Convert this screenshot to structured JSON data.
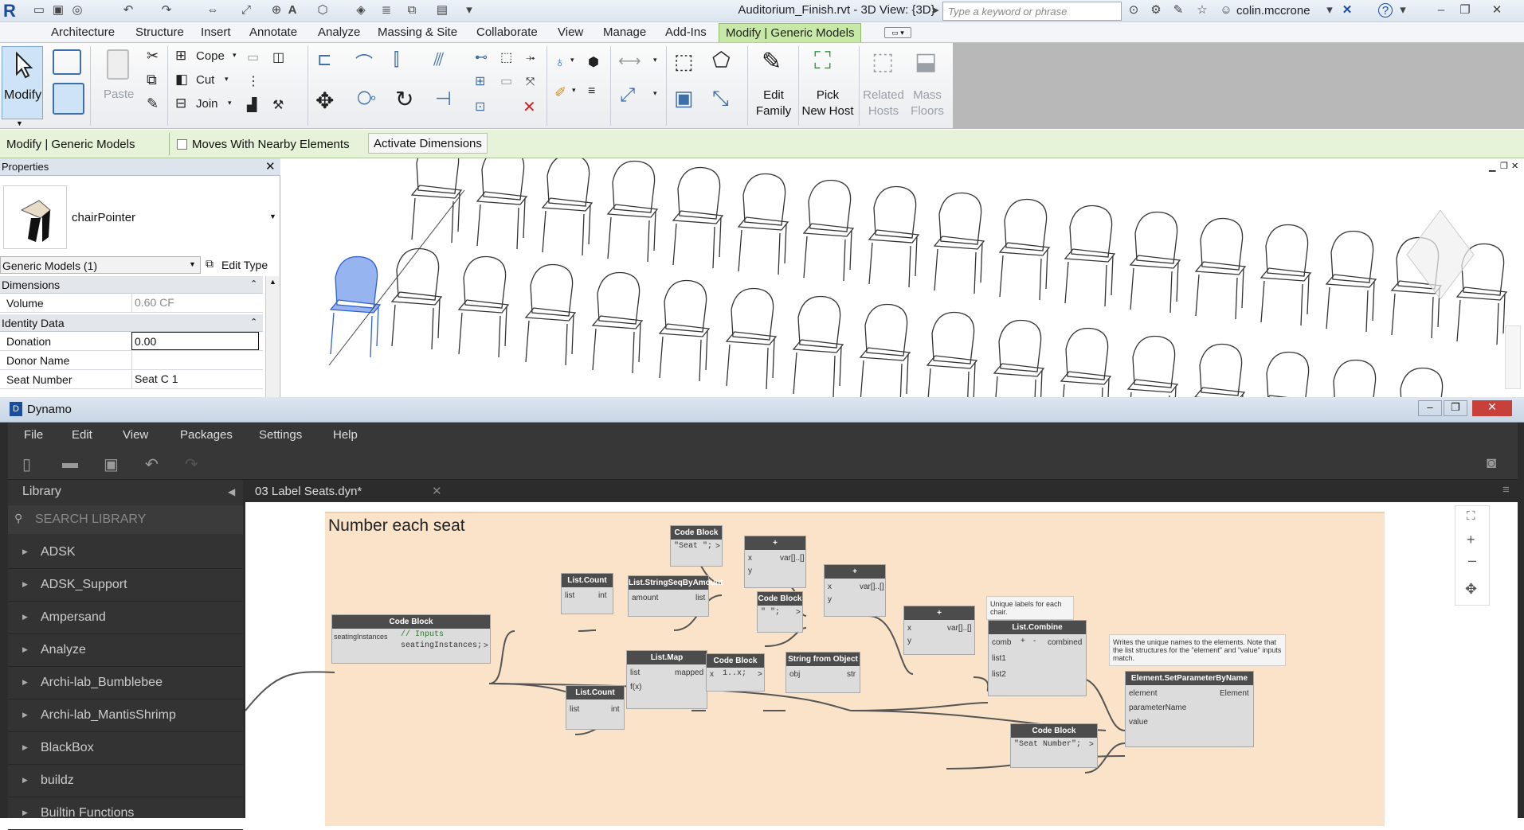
{
  "app": {
    "window_title": "Auditorium_Finish.rvt - 3D View: {3D}",
    "search_placeholder": "Type a keyword or phrase",
    "user": "colin.mccrone"
  },
  "ribbon_tabs": [
    "Architecture",
    "Structure",
    "Insert",
    "Annotate",
    "Analyze",
    "Massing & Site",
    "Collaborate",
    "View",
    "Manage",
    "Add-Ins",
    "Modify | Generic Models"
  ],
  "ribbon": {
    "modify": "Modify",
    "paste": "Paste",
    "cope": "Cope",
    "cut": "Cut",
    "join": "Join",
    "edit_family": [
      "Edit",
      "Family"
    ],
    "pick_new_host": [
      "Pick",
      "New Host"
    ],
    "related_hosts": [
      "Related",
      "Hosts"
    ],
    "mass_floors": [
      "Mass",
      "Floors"
    ]
  },
  "context_bar": {
    "label": "Modify | Generic Models",
    "moves_with": "Moves With Nearby Elements",
    "activate": "Activate Dimensions"
  },
  "properties": {
    "title": "Properties",
    "family": "chairPointer",
    "selector": "Generic Models (1)",
    "edit_type": "Edit Type",
    "groups": {
      "dimensions": "Dimensions",
      "identity": "Identity Data"
    },
    "rows": [
      {
        "k": "Volume",
        "v": "0.60 CF"
      },
      {
        "k": "Donation",
        "v": "0.00"
      },
      {
        "k": "Donor Name",
        "v": ""
      },
      {
        "k": "Seat Number",
        "v": "Seat C 1"
      }
    ]
  },
  "dynamo": {
    "title": "Dynamo",
    "menu": [
      "File",
      "Edit",
      "View",
      "Packages",
      "Settings",
      "Help"
    ],
    "library": {
      "title": "Library",
      "search_placeholder": "SEARCH LIBRARY",
      "items": [
        "ADSK",
        "ADSK_Support",
        "Ampersand",
        "Analyze",
        "Archi-lab_Bumblebee",
        "Archi-lab_MantisShrimp",
        "BlackBox",
        "buildz",
        "Builtin Functions"
      ]
    },
    "file_tab": "03 Label Seats.dyn*",
    "group_title": "Number each seat",
    "nodes": {
      "cb_seat": {
        "title": "Code Block",
        "code": "\"Seat \";"
      },
      "cb_space": {
        "title": "Code Block",
        "code": "\" \";"
      },
      "cb_main": {
        "title": "Code Block",
        "port": "seatingInstances",
        "code1": "// Inputs",
        "code2": "seatingInstances;"
      },
      "cb_range": {
        "title": "Code Block",
        "code": "1..x;",
        "port": "x"
      },
      "cb_param": {
        "title": "Code Block",
        "code": "\"Seat Number\";"
      },
      "count1": {
        "title": "List.Count",
        "in": "list",
        "out": "int"
      },
      "count2": {
        "title": "List.Count",
        "in": "list",
        "out": "int"
      },
      "seq": {
        "title": "List.StringSeqByAmount",
        "in": "amount",
        "out": "list"
      },
      "plus1": {
        "title": "+",
        "x": "x",
        "y": "y",
        "out": "var[]..[]"
      },
      "plus2": {
        "title": "+",
        "x": "x",
        "y": "y",
        "out": "var[]..[]"
      },
      "plus3": {
        "title": "+",
        "x": "x",
        "y": "y",
        "out": "var[]..[]"
      },
      "map": {
        "title": "List.Map",
        "in1": "list",
        "in2": "f(x)",
        "out": "mapped"
      },
      "sfo": {
        "title": "String from Object",
        "in": "obj",
        "out": "str"
      },
      "combine": {
        "title": "List.Combine",
        "in1": "comb",
        "in2": "list1",
        "in3": "list2",
        "out": "combined"
      },
      "setparam": {
        "title": "Element.SetParameterByName",
        "in1": "element",
        "in2": "parameterName",
        "in3": "value",
        "out": "Element"
      }
    },
    "notes": {
      "unique": "Unique labels for each chair.",
      "writes": "Writes the unique names to the elements.  Note that the list structures for the \"element\" and \"value\" inputs match."
    }
  }
}
